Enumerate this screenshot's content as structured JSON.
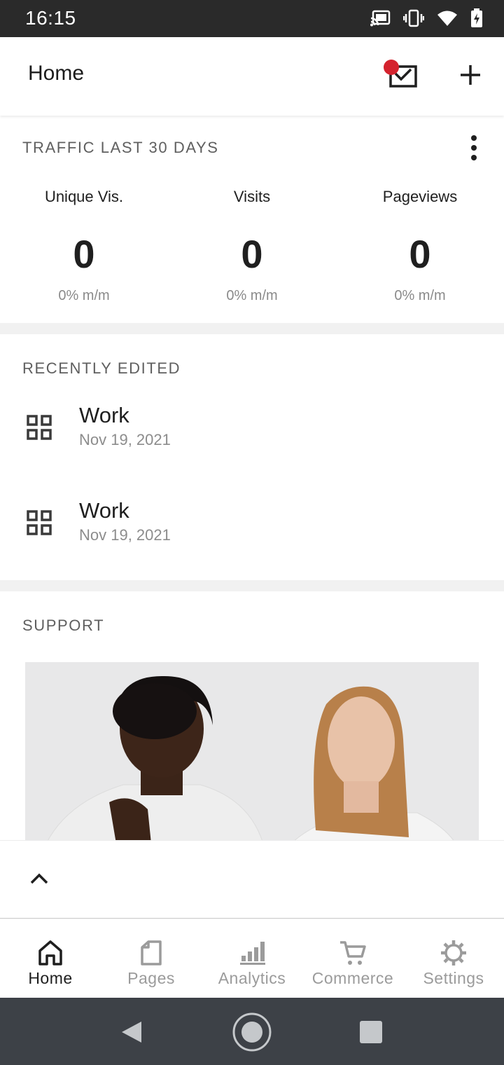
{
  "status_bar": {
    "time": "16:15",
    "icons": [
      "cast-icon",
      "vibrate-icon",
      "wifi-icon",
      "battery-charging-icon"
    ]
  },
  "app_bar": {
    "title": "Home",
    "actions": [
      {
        "name": "inbox-icon",
        "has_notification": true
      },
      {
        "name": "add-icon"
      }
    ]
  },
  "traffic": {
    "title": "TRAFFIC LAST 30 DAYS",
    "stats": [
      {
        "label": "Unique Vis.",
        "value": "0",
        "change": "0% m/m"
      },
      {
        "label": "Visits",
        "value": "0",
        "change": "0% m/m"
      },
      {
        "label": "Pageviews",
        "value": "0",
        "change": "0% m/m"
      }
    ]
  },
  "recently_edited": {
    "title": "RECENTLY EDITED",
    "items": [
      {
        "name": "Work",
        "date": "Nov 19, 2021",
        "icon": "grid-icon"
      },
      {
        "name": "Work",
        "date": "Nov 19, 2021",
        "icon": "grid-icon"
      }
    ]
  },
  "support": {
    "title": "SUPPORT"
  },
  "bottom_nav": {
    "items": [
      {
        "label": "Home",
        "icon": "home-icon",
        "active": true
      },
      {
        "label": "Pages",
        "icon": "page-icon",
        "active": false
      },
      {
        "label": "Analytics",
        "icon": "bar-chart-icon",
        "active": false
      },
      {
        "label": "Commerce",
        "icon": "cart-icon",
        "active": false
      },
      {
        "label": "Settings",
        "icon": "gear-icon",
        "active": false
      }
    ]
  },
  "colors": {
    "notification_dot": "#d4232e",
    "text_primary": "#1f1f1f",
    "text_secondary": "#8a8a8a",
    "system_nav": "#3d4147"
  }
}
